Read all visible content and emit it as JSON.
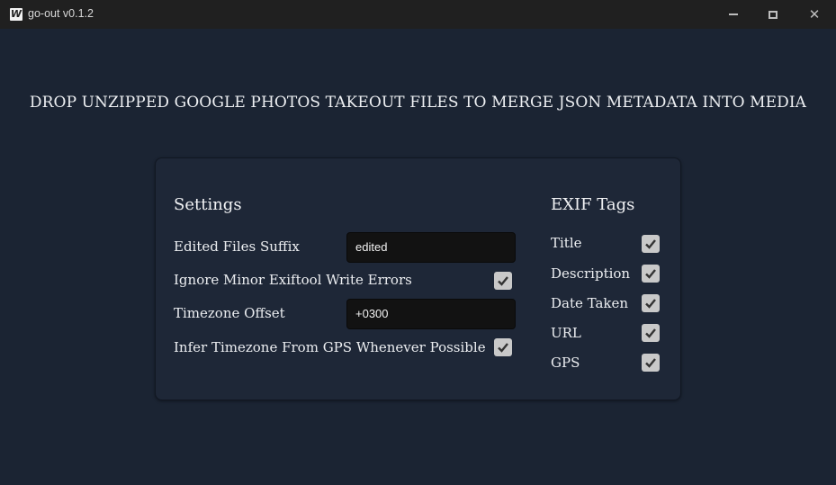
{
  "window": {
    "icon_letter": "W",
    "title": "go-out v0.1.2",
    "controls": {
      "minimize": "minimize-icon",
      "maximize": "maximize-icon",
      "close": "close-icon",
      "close_glyph": "✕"
    }
  },
  "headline": "DROP UNZIPPED GOOGLE PHOTOS TAKEOUT FILES TO MERGE JSON METADATA INTO MEDIA",
  "settings": {
    "title": "Settings",
    "edited_suffix": {
      "label": "Edited Files Suffix",
      "value": "edited"
    },
    "ignore_errors": {
      "label": "Ignore Minor Exiftool Write Errors",
      "checked": true
    },
    "timezone_offset": {
      "label": "Timezone Offset",
      "value": "+0300"
    },
    "infer_timezone": {
      "label": "Infer Timezone From GPS Whenever Possible",
      "checked": true
    }
  },
  "exif": {
    "title": "EXIF Tags",
    "tags": [
      {
        "label": "Title",
        "checked": true
      },
      {
        "label": "Description",
        "checked": true
      },
      {
        "label": "Date Taken",
        "checked": true
      },
      {
        "label": "URL",
        "checked": true
      },
      {
        "label": "GPS",
        "checked": true
      }
    ]
  },
  "colors": {
    "background": "#1b2433",
    "panel": "#1e2737",
    "titlebar": "#202020",
    "input": "#121212",
    "checkbox": "#c9c9c9"
  }
}
